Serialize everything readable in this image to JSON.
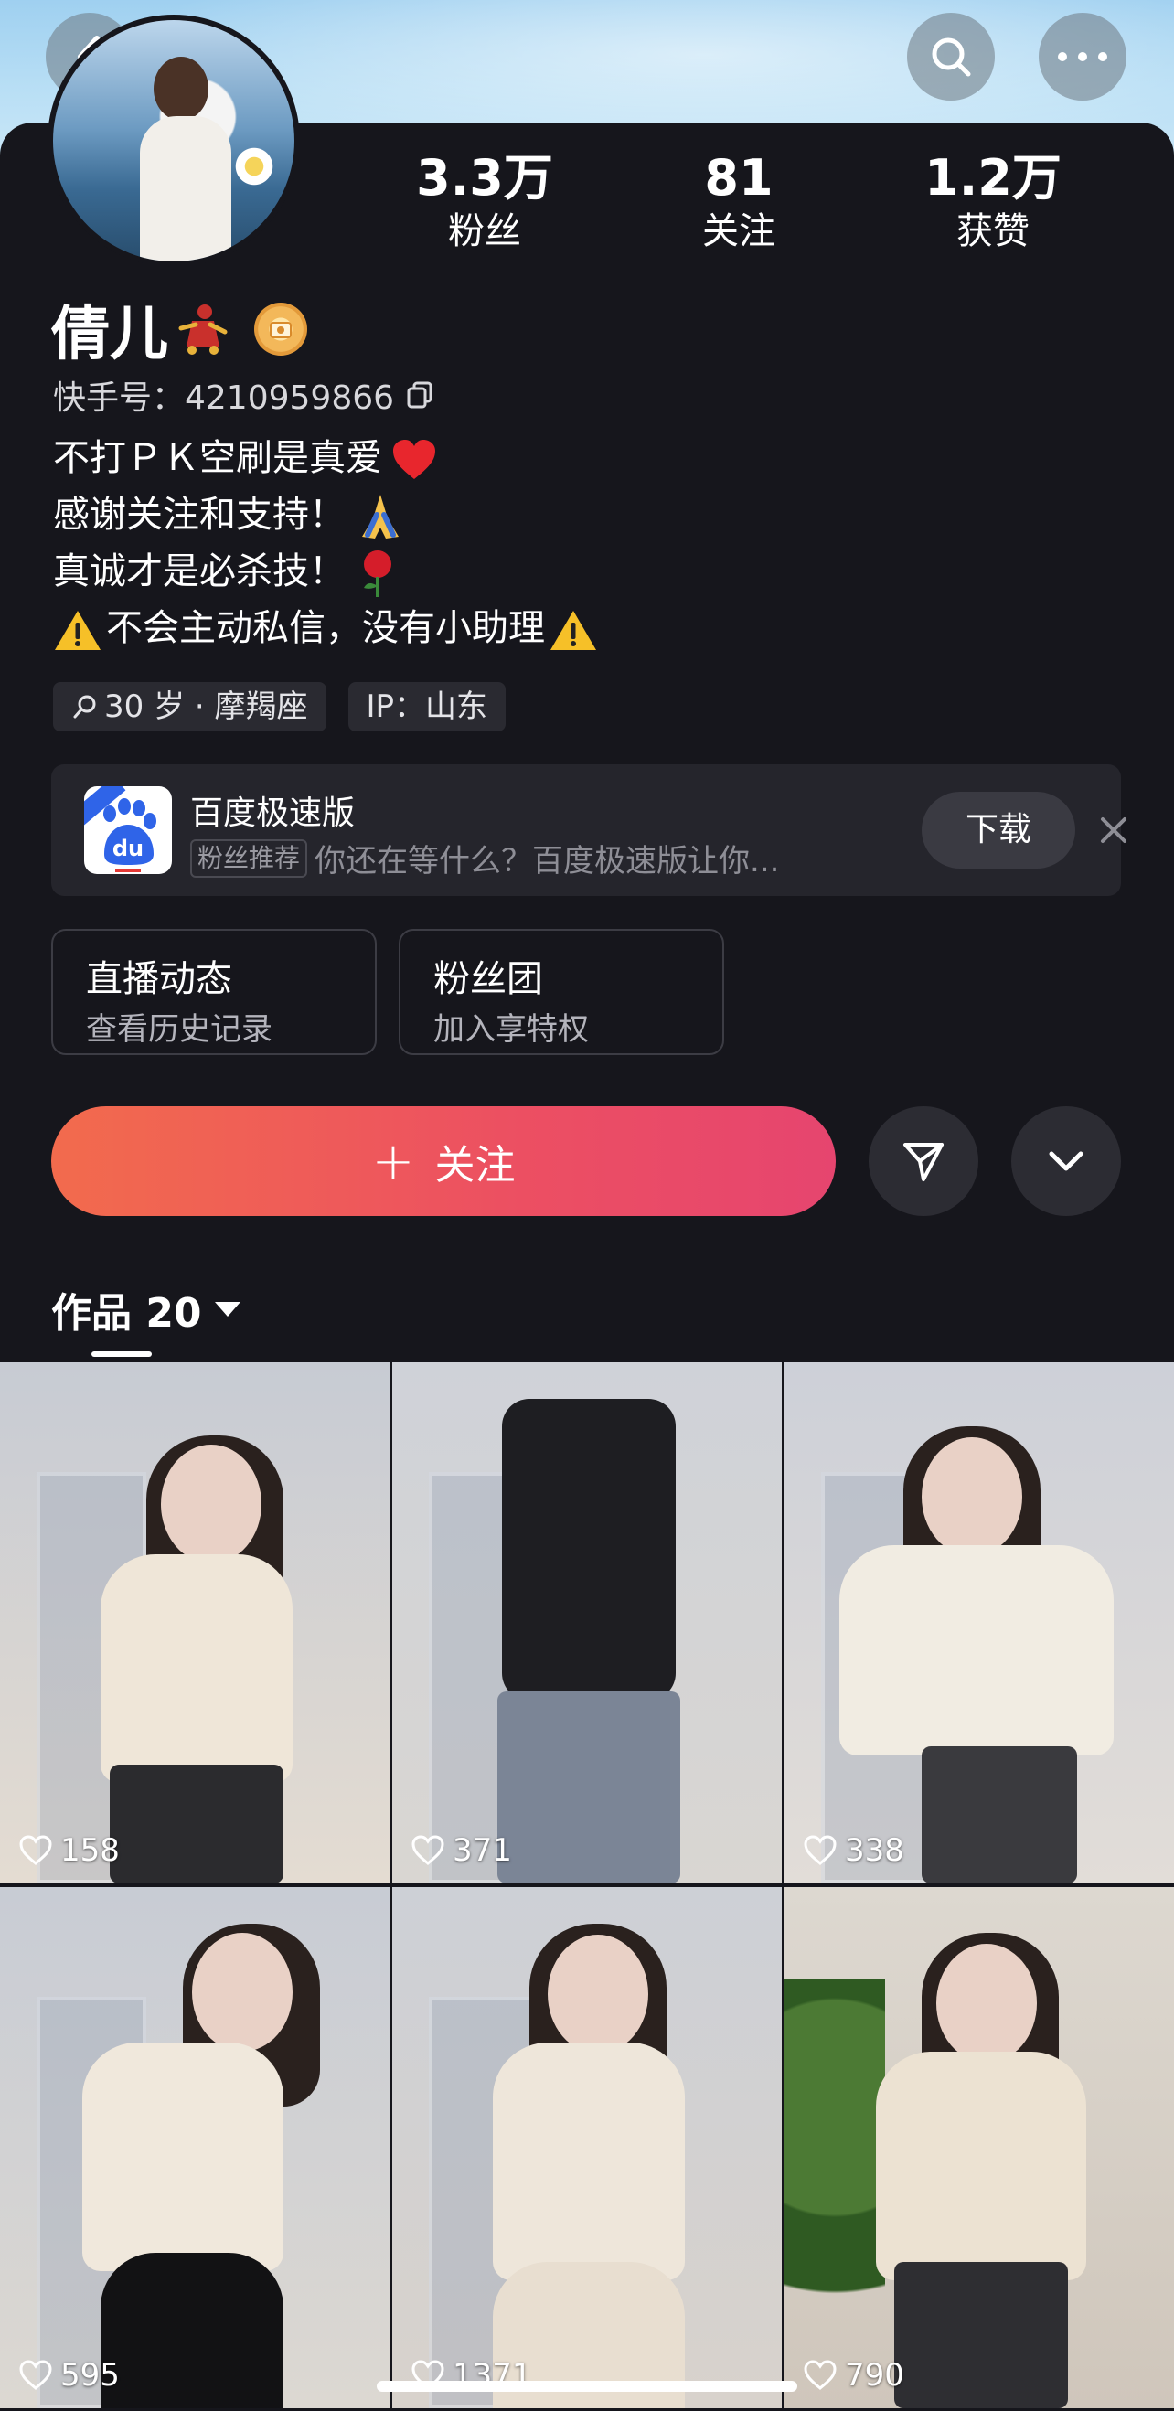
{
  "nav": {
    "back_icon": "chevron-left-icon",
    "search_icon": "search-icon",
    "more_icon": "more-dots-icon"
  },
  "profile": {
    "name": "倩儿",
    "uid_label": "快手号：4210959866",
    "stats": [
      {
        "value": "3.3万",
        "label": "粉丝"
      },
      {
        "value": "81",
        "label": "关注"
      },
      {
        "value": "1.2万",
        "label": "获赞"
      }
    ],
    "bio": [
      "不打ＰＫ空刷是真爱",
      "感谢关注和支持！",
      "真诚才是必杀技！",
      "不会主动私信，没有小助理"
    ],
    "tags": [
      "30 岁 · 摩羯座",
      "IP：山东"
    ]
  },
  "ad": {
    "title": "百度极速版",
    "tag": "粉丝推荐",
    "text": "你还在等什么？百度极速版让你...",
    "button": "下载"
  },
  "boxes": [
    {
      "title": "直播动态",
      "subtitle": "查看历史记录"
    },
    {
      "title": "粉丝团",
      "subtitle": "加入享特权"
    }
  ],
  "actions": {
    "follow_label": "关注",
    "plus": "+"
  },
  "works": {
    "label": "作品 20"
  },
  "thumbnails": [
    {
      "likes": "158",
      "top": "#c7cbd3",
      "bottom": "#e4dcd2",
      "outfit": "#efe6d8",
      "legs": "#2b2b2e"
    },
    {
      "likes": "371",
      "top": "#cfd2d8",
      "bottom": "#d9d6d2",
      "outfit": "#1e1e22",
      "legs": "#7b8596"
    },
    {
      "likes": "338",
      "top": "#cdd0d8",
      "bottom": "#e2ddd8",
      "outfit": "#f1ece2",
      "legs": "#3a3a3e"
    },
    {
      "likes": "595",
      "top": "#c8ccd4",
      "bottom": "#dcd8d2",
      "outfit": "#f0e8dc",
      "legs": "#121214"
    },
    {
      "likes": "1371",
      "top": "#cdd0d6",
      "bottom": "#d8d2cc",
      "outfit": "#eee6da",
      "legs": "#e8ded0"
    },
    {
      "likes": "790",
      "top": "#ddd8d0",
      "bottom": "#cfc6bb",
      "outfit": "#ece2d2",
      "legs": "#2e2e32"
    }
  ],
  "colors": {
    "background": "#16161c",
    "follow_start": "#f26b4d",
    "follow_end": "#e6456f"
  }
}
